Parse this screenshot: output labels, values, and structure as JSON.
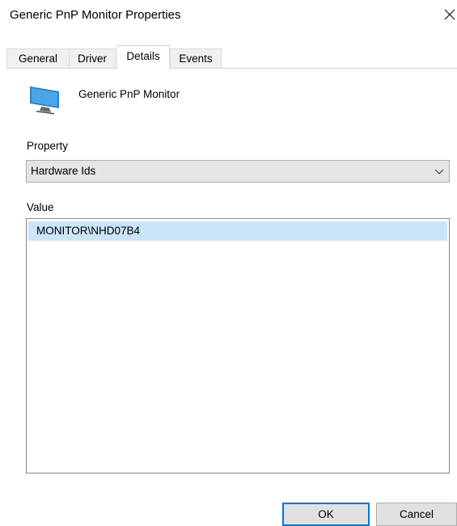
{
  "window": {
    "title": "Generic PnP Monitor Properties",
    "close_glyph": "✕"
  },
  "tabs": [
    {
      "label": "General",
      "active": false
    },
    {
      "label": "Driver",
      "active": false
    },
    {
      "label": "Details",
      "active": true
    },
    {
      "label": "Events",
      "active": false
    }
  ],
  "device": {
    "icon": "monitor-icon",
    "name": "Generic PnP Monitor"
  },
  "property": {
    "label": "Property",
    "selected": "Hardware Ids"
  },
  "value": {
    "label": "Value",
    "items": [
      "MONITOR\\NHD07B4"
    ]
  },
  "buttons": {
    "ok": "OK",
    "cancel": "Cancel"
  },
  "colors": {
    "accent": "#0078d7",
    "selection": "#cce4f7",
    "monitor_screen": "#4aa6e8"
  }
}
